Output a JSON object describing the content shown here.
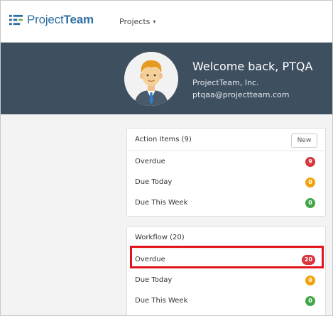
{
  "nav": {
    "logo_light": "Project",
    "logo_bold": "Team",
    "projects_label": "Projects",
    "caret": "▾"
  },
  "hero": {
    "welcome": "Welcome back, PTQA",
    "company": "ProjectTeam, Inc.",
    "email": "ptqaa@projectteam.com"
  },
  "action_items": {
    "title": "Action Items (9)",
    "new_label": "New",
    "rows": [
      {
        "label": "Overdue",
        "count": "9",
        "color": "#d9363e"
      },
      {
        "label": "Due Today",
        "count": "0",
        "color": "#f0a30a"
      },
      {
        "label": "Due This Week",
        "count": "0",
        "color": "#43a648"
      }
    ]
  },
  "workflow": {
    "title": "Workflow (20)",
    "rows": [
      {
        "label": "Overdue",
        "count": "20",
        "color": "#d9363e"
      },
      {
        "label": "Due Today",
        "count": "0",
        "color": "#f0a30a"
      },
      {
        "label": "Due This Week",
        "count": "0",
        "color": "#43a648"
      }
    ]
  },
  "colors": {
    "brand": "#2d6ea3",
    "hero_bg": "#3e4f60",
    "highlight": "#e3141b"
  }
}
